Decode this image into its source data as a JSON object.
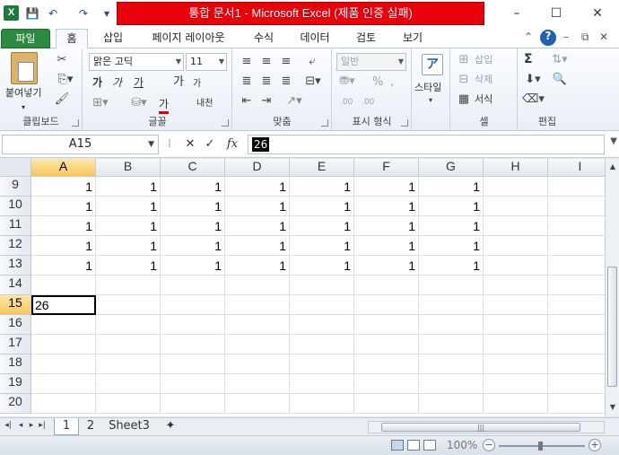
{
  "window": {
    "title": "통합 문서1 - Microsoft Excel (제품 인증 실패)",
    "app_icon": "X",
    "qa_save": "💾",
    "qa_undo": "↶",
    "qa_redo": "↷",
    "minimize": "–",
    "maximize": "☐",
    "close": "✕"
  },
  "ribbon_tabs": [
    "파일",
    "홈",
    "삽입",
    "페이지 레이아웃",
    "수식",
    "데이터",
    "검토",
    "보기"
  ],
  "ribbon_right_icons": {
    "help": "?",
    "minimize_ribbon": "⌃",
    "restore": "⧉",
    "close": "✕"
  },
  "ribbon": {
    "clipboard": {
      "label": "클립보드",
      "paste": "붙여넣기"
    },
    "font": {
      "label": "글꼴",
      "font_name": "맑은 고딕",
      "font_size": "11",
      "bold": "가",
      "italic": "가",
      "underline": "가",
      "grow": "가",
      "shrink": "가",
      "phonetic": "내천",
      "font_color": "가"
    },
    "alignment": {
      "label": "맞춤"
    },
    "number": {
      "label": "표시 형식",
      "format": "일반",
      "percent": "%",
      "comma": ",",
      "inc_decimal": ".00",
      "dec_decimal": ".00"
    },
    "styles": {
      "label": "스타일"
    },
    "cells": {
      "label": "셀",
      "insert": "삽입",
      "delete": "삭제",
      "format": "서식"
    },
    "editing": {
      "label": "편집",
      "sum": "Σ"
    }
  },
  "formula_bar": {
    "name_box": "A15",
    "cancel": "✕",
    "enter": "✓",
    "fx": "fx",
    "value": "26"
  },
  "grid": {
    "columns": [
      "A",
      "B",
      "C",
      "D",
      "E",
      "F",
      "G",
      "H",
      "I"
    ],
    "rows": [
      {
        "num": "9",
        "cells": [
          "1",
          "1",
          "1",
          "1",
          "1",
          "1",
          "1",
          "",
          ""
        ]
      },
      {
        "num": "10",
        "cells": [
          "1",
          "1",
          "1",
          "1",
          "1",
          "1",
          "1",
          "",
          ""
        ]
      },
      {
        "num": "11",
        "cells": [
          "1",
          "1",
          "1",
          "1",
          "1",
          "1",
          "1",
          "",
          ""
        ]
      },
      {
        "num": "12",
        "cells": [
          "1",
          "1",
          "1",
          "1",
          "1",
          "1",
          "1",
          "",
          ""
        ]
      },
      {
        "num": "13",
        "cells": [
          "1",
          "1",
          "1",
          "1",
          "1",
          "1",
          "1",
          "",
          ""
        ]
      },
      {
        "num": "14",
        "cells": [
          "",
          "",
          "",
          "",
          "",
          "",
          "",
          "",
          ""
        ]
      },
      {
        "num": "15",
        "cells": [
          "26",
          "",
          "",
          "",
          "",
          "",
          "",
          "",
          ""
        ]
      },
      {
        "num": "16",
        "cells": [
          "",
          "",
          "",
          "",
          "",
          "",
          "",
          "",
          ""
        ]
      },
      {
        "num": "17",
        "cells": [
          "",
          "",
          "",
          "",
          "",
          "",
          "",
          "",
          ""
        ]
      },
      {
        "num": "18",
        "cells": [
          "",
          "",
          "",
          "",
          "",
          "",
          "",
          "",
          ""
        ]
      },
      {
        "num": "19",
        "cells": [
          "",
          "",
          "",
          "",
          "",
          "",
          "",
          "",
          ""
        ]
      },
      {
        "num": "20",
        "cells": [
          "",
          "",
          "",
          "",
          "",
          "",
          "",
          "",
          ""
        ]
      }
    ],
    "selected_column": "A",
    "selected_row": "15"
  },
  "sheet_tabs": [
    "1",
    "2",
    "Sheet3"
  ],
  "active_sheet": "1",
  "status": {
    "zoom": "100%",
    "zoom_minus": "−",
    "zoom_plus": "+"
  }
}
